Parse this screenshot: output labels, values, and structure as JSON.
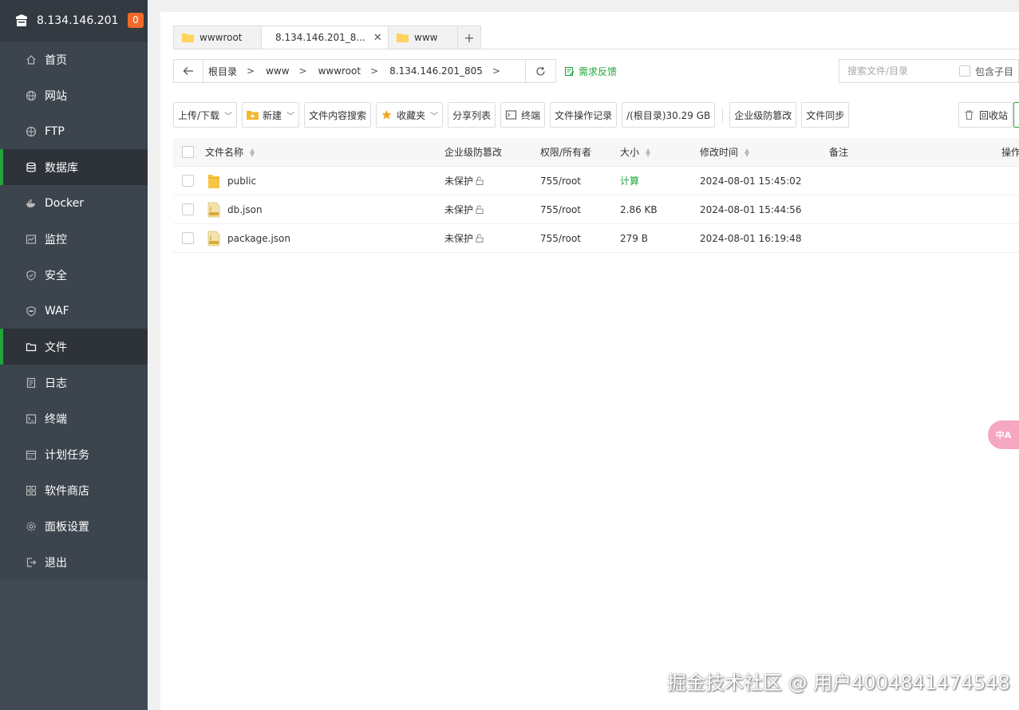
{
  "sidebar": {
    "host": "8.134.146.201",
    "badge": "0",
    "items": [
      {
        "label": "首页",
        "icon": "home-icon"
      },
      {
        "label": "网站",
        "icon": "globe-icon"
      },
      {
        "label": "FTP",
        "icon": "ftp-icon"
      },
      {
        "label": "数据库",
        "icon": "database-icon"
      },
      {
        "label": "Docker",
        "icon": "docker-icon"
      },
      {
        "label": "监控",
        "icon": "monitor-icon"
      },
      {
        "label": "安全",
        "icon": "shield-icon"
      },
      {
        "label": "WAF",
        "icon": "waf-icon"
      },
      {
        "label": "文件",
        "icon": "folder-icon"
      },
      {
        "label": "日志",
        "icon": "log-icon"
      },
      {
        "label": "终端",
        "icon": "terminal-icon"
      },
      {
        "label": "计划任务",
        "icon": "calendar-icon"
      },
      {
        "label": "软件商店",
        "icon": "apps-icon"
      },
      {
        "label": "面板设置",
        "icon": "gear-icon"
      },
      {
        "label": "退出",
        "icon": "logout-icon"
      }
    ]
  },
  "tabs": [
    {
      "label": "wwwroot"
    },
    {
      "label": "8.134.146.201_8...",
      "close": "✕"
    },
    {
      "label": "www"
    }
  ],
  "tab_add": "+",
  "path": {
    "crumbs": [
      "根目录",
      "www",
      "wwwroot",
      "8.134.146.201_805"
    ],
    "feedback": "需求反馈"
  },
  "search": {
    "placeholder": "搜索文件/目录",
    "include_sub": "包含子目"
  },
  "toolbar": {
    "upload": "上传/下载",
    "new": "新建",
    "content_search": "文件内容搜索",
    "favorites": "收藏夹",
    "share_list": "分享列表",
    "terminal": "终端",
    "op_log": "文件操作记录",
    "disk": "/(根目录)30.29 GB",
    "tamper": "企业级防篡改",
    "sync": "文件同步",
    "recycle": "回收站"
  },
  "table": {
    "headers": {
      "name": "文件名称",
      "tamper": "企业级防篡改",
      "perm": "权限/所有者",
      "size": "大小",
      "mtime": "修改时间",
      "note": "备注",
      "ops": "操作"
    },
    "rows": [
      {
        "name": "public",
        "type": "folder",
        "tamper": "未保护",
        "perm": "755/root",
        "size": "计算",
        "mtime": "2024-08-01 15:45:02"
      },
      {
        "name": "db.json",
        "type": "file",
        "tamper": "未保护",
        "perm": "755/root",
        "size": "2.86 KB",
        "mtime": "2024-08-01 15:44:56"
      },
      {
        "name": "package.json",
        "type": "file",
        "tamper": "未保护",
        "perm": "755/root",
        "size": "279 B",
        "mtime": "2024-08-01 16:19:48"
      }
    ]
  },
  "translate": "中A",
  "watermark": "掘金技术社区 @ 用户4004841474548",
  "colors": {
    "sidebar": "#3c444d",
    "accent": "#20a53a",
    "badge": "#f0692b"
  }
}
